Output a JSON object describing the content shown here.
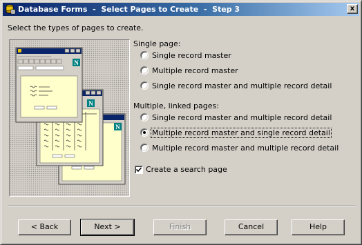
{
  "window": {
    "title": "Database Forms  -  Select Pages to Create  -  Step 3",
    "close_glyph": "x"
  },
  "instruction": "Select the types of pages to create.",
  "single_page": {
    "label": "Single page:",
    "options": [
      {
        "label": "Single record master",
        "checked": false
      },
      {
        "label": "Multiple record master",
        "checked": false
      },
      {
        "label": "Single record master and multiple record detail",
        "checked": false
      }
    ]
  },
  "multiple_pages": {
    "label": "Multiple, linked pages:",
    "options": [
      {
        "label": "Single record master and multiple record detail",
        "checked": false
      },
      {
        "label": "Multiple record master and single record detail",
        "checked": true
      },
      {
        "label": "Multiple record master and multiple record detail",
        "checked": false
      }
    ]
  },
  "search_page": {
    "label": "Create a search page",
    "checked": true
  },
  "buttons": {
    "back": "< Back",
    "next": "Next >",
    "finish": "Finish",
    "cancel": "Cancel",
    "help": "Help"
  },
  "colors": {
    "dialog": "#d4d0c8",
    "title_start": "#0a246a",
    "title_end": "#a6caf0",
    "form_bg": "#ffffcc",
    "navigator_icon": "#008080"
  },
  "preview_icons": [
    "netscape-n-icon",
    "netscape-n-icon",
    "netscape-n-icon"
  ]
}
